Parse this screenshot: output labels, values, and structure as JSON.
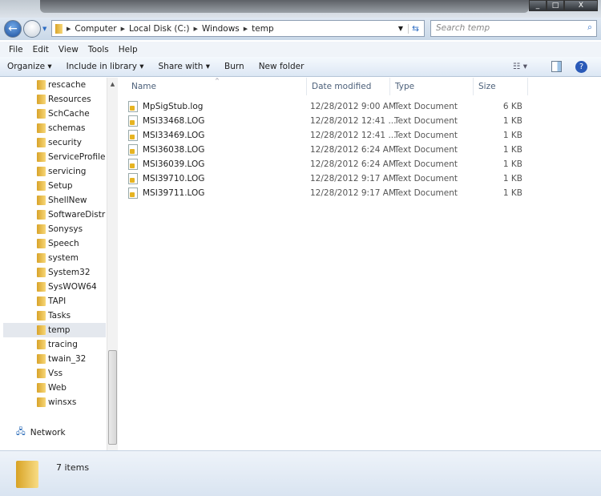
{
  "window": {
    "minimize": "_",
    "maximize": "□",
    "close": "X"
  },
  "address": {
    "crumbs": [
      "Computer",
      "Local Disk (C:)",
      "Windows",
      "temp"
    ],
    "search_placeholder": "Search temp"
  },
  "menu": [
    "File",
    "Edit",
    "View",
    "Tools",
    "Help"
  ],
  "toolbar": {
    "organize": "Organize ▾",
    "include": "Include in library ▾",
    "share": "Share with ▾",
    "burn": "Burn",
    "new_folder": "New folder"
  },
  "nav": {
    "folders": [
      "rescache",
      "Resources",
      "SchCache",
      "schemas",
      "security",
      "ServiceProfiles",
      "servicing",
      "Setup",
      "ShellNew",
      "SoftwareDistrib",
      "Sonysys",
      "Speech",
      "system",
      "System32",
      "SysWOW64",
      "TAPI",
      "Tasks",
      "temp",
      "tracing",
      "twain_32",
      "Vss",
      "Web",
      "winsxs"
    ],
    "selected": "temp",
    "network": "Network"
  },
  "columns": [
    "Name",
    "Date modified",
    "Type",
    "Size"
  ],
  "files": [
    {
      "name": "MpSigStub.log",
      "date": "12/28/2012 9:00 AM",
      "type": "Text Document",
      "size": "6 KB"
    },
    {
      "name": "MSI33468.LOG",
      "date": "12/28/2012 12:41 ...",
      "type": "Text Document",
      "size": "1 KB"
    },
    {
      "name": "MSI33469.LOG",
      "date": "12/28/2012 12:41 ...",
      "type": "Text Document",
      "size": "1 KB"
    },
    {
      "name": "MSI36038.LOG",
      "date": "12/28/2012 6:24 AM",
      "type": "Text Document",
      "size": "1 KB"
    },
    {
      "name": "MSI36039.LOG",
      "date": "12/28/2012 6:24 AM",
      "type": "Text Document",
      "size": "1 KB"
    },
    {
      "name": "MSI39710.LOG",
      "date": "12/28/2012 9:17 AM",
      "type": "Text Document",
      "size": "1 KB"
    },
    {
      "name": "MSI39711.LOG",
      "date": "12/28/2012 9:17 AM",
      "type": "Text Document",
      "size": "1 KB"
    }
  ],
  "status": {
    "count": "7 items"
  }
}
